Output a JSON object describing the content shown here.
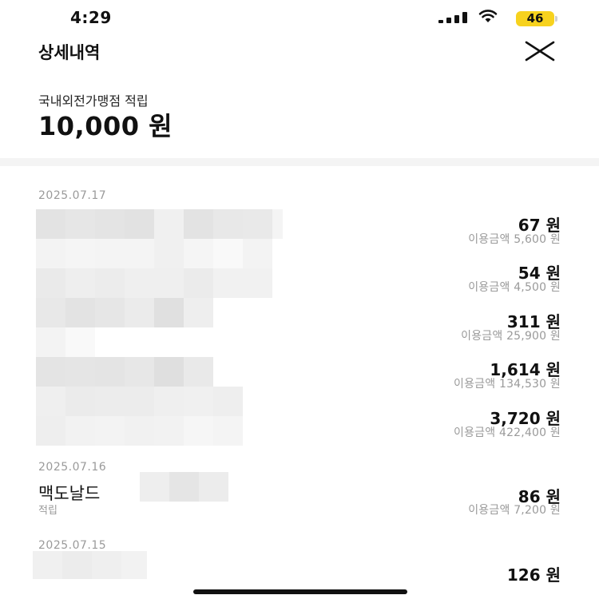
{
  "status_bar": {
    "time": "4:29",
    "battery_level": "46",
    "battery_color": "#f7d21e",
    "icons": [
      "signal-icon",
      "wifi-icon",
      "battery-icon"
    ]
  },
  "header": {
    "title": "상세내역",
    "close_icon": "close-icon"
  },
  "summary": {
    "label": "국내외전가맹점 적립",
    "total": "10,000 원"
  },
  "groups": [
    {
      "date": "2025.07.17",
      "items": [
        {
          "amount": "67 원",
          "usage": "이용금액 5,600 원"
        },
        {
          "amount": "54 원",
          "usage": "이용금액 4,500 원"
        },
        {
          "amount": "311 원",
          "usage": "이용금액 25,900 원"
        },
        {
          "amount": "1,614 원",
          "usage": "이용금액 134,530 원"
        },
        {
          "amount": "3,720 원",
          "usage": "이용금액 422,400 원"
        }
      ]
    },
    {
      "date": "2025.07.16",
      "items": [
        {
          "merchant": "맥도날드",
          "type": "적립",
          "amount": "86 원",
          "usage": "이용금액 7,200 원"
        }
      ]
    },
    {
      "date": "2025.07.15",
      "items": [
        {
          "amount": "126 원"
        }
      ]
    }
  ]
}
